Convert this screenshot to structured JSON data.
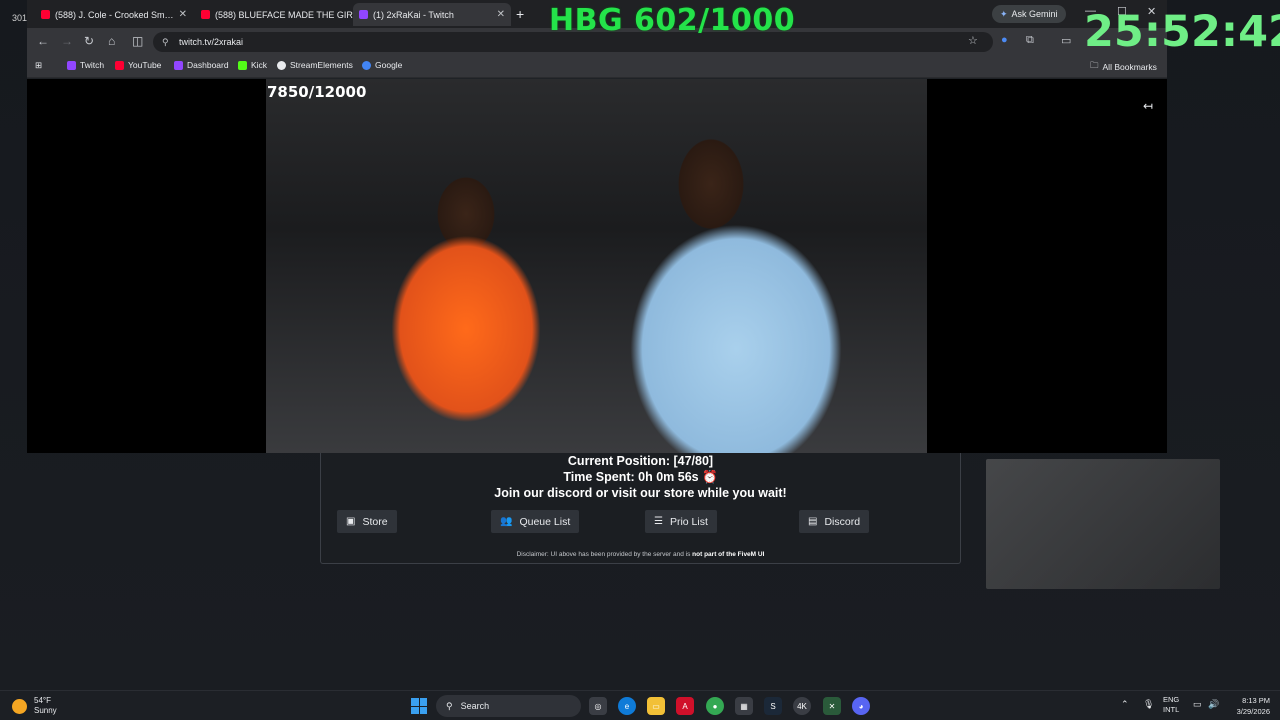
{
  "corner_number": "301",
  "stream_overlay": {
    "hbg_text": "HBG 602/1000",
    "timer": "25:52:42",
    "sub_count": "7850/12000"
  },
  "browser": {
    "tabs": [
      {
        "label": "(588) J. Cole - Crooked Sm…",
        "favicon_color": "#ff0033"
      },
      {
        "label": "(588) BLUEFACE MADE THE GIR…",
        "favicon_color": "#ff0033"
      },
      {
        "label": "(1) 2xRaKai - Twitch",
        "favicon_color": "#9146ff"
      }
    ],
    "ask_gemini": "Ask Gemini",
    "url": "twitch.tv/2xrakai",
    "bookmarks": [
      {
        "label": "Twitch",
        "color": "#9146ff"
      },
      {
        "label": "YouTube",
        "color": "#ff0033"
      },
      {
        "label": "Dashboard",
        "color": "#9146ff"
      },
      {
        "label": "Kick",
        "color": "#53fc18"
      },
      {
        "label": "StreamElements",
        "color": "#e8eaed"
      },
      {
        "label": "Google",
        "color": "#4285f4"
      }
    ],
    "all_bookmarks": "All Bookmarks"
  },
  "queue": {
    "position_text": "Current Position: [47/80]",
    "time_text": "Time Spent: 0h 0m 56s ⏰",
    "join_text": "Join our discord or visit our store while you wait!",
    "buttons": {
      "store": "Store",
      "queue_list": "Queue List",
      "prio_list": "Prio List",
      "discord": "Discord"
    },
    "disclaimer_prefix": "Disclaimer: UI above has been provided by the server and is ",
    "disclaimer_bold": "not part of the FiveM UI"
  },
  "taskbar": {
    "weather_temp": "54°F",
    "weather_desc": "Sunny",
    "search_label": "Search",
    "lang_top": "ENG",
    "lang_bottom": "INTL",
    "time": "8:13 PM",
    "date": "3/29/2026"
  }
}
